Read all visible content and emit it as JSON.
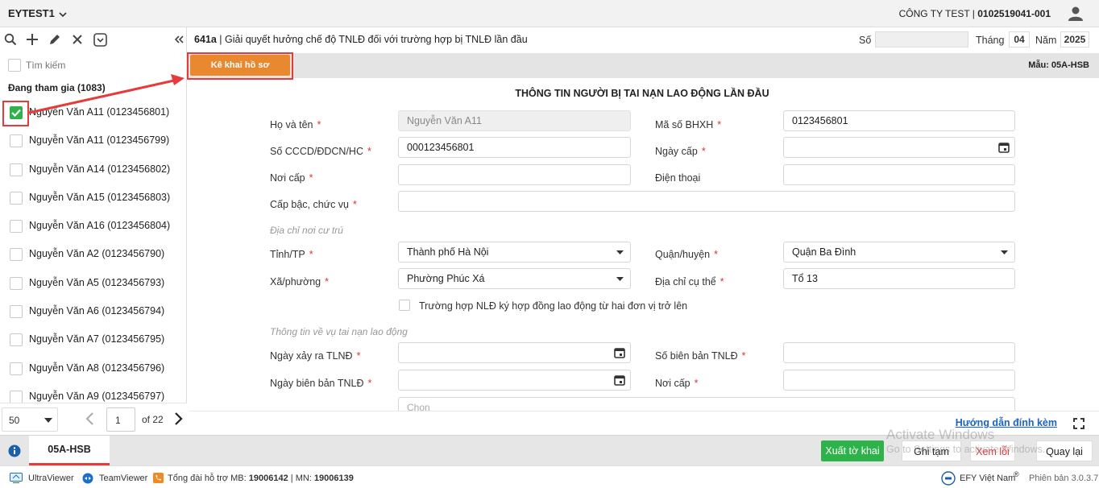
{
  "topbar": {
    "tenant": "EYTEST1",
    "company_name": "CÔNG TY TEST | ",
    "company_code": "0102519041-001"
  },
  "sidebar": {
    "search_placeholder": "Tìm kiếm",
    "group_label": "Đang tham gia (1083)",
    "items": [
      {
        "label": "Nguyễn Văn A11 (0123456801)",
        "checked": true
      },
      {
        "label": "Nguyễn Văn A11 (0123456799)",
        "checked": false
      },
      {
        "label": "Nguyễn Văn A14 (0123456802)",
        "checked": false
      },
      {
        "label": "Nguyễn Văn A15 (0123456803)",
        "checked": false
      },
      {
        "label": "Nguyễn Văn A16 (0123456804)",
        "checked": false
      },
      {
        "label": "Nguyễn Văn A2 (0123456790)",
        "checked": false
      },
      {
        "label": "Nguyễn Văn A5 (0123456793)",
        "checked": false
      },
      {
        "label": "Nguyễn Văn A6 (0123456794)",
        "checked": false
      },
      {
        "label": "Nguyễn Văn A7 (0123456795)",
        "checked": false
      },
      {
        "label": "Nguyễn Văn A8 (0123456796)",
        "checked": false
      },
      {
        "label": "Nguyễn Văn A9 (0123456797)",
        "checked": false
      }
    ],
    "pager": {
      "page_size": "50",
      "page": "1",
      "of_label": "of 22"
    }
  },
  "header": {
    "proc_code": "641a",
    "proc_title": " | Giải quyết hưởng chế độ TNLĐ đối với trường hợp bị TNLĐ lần đầu",
    "so_label": "Số",
    "so_value": "",
    "thang_label": "Tháng",
    "thang_value": "04",
    "nam_label": "Năm",
    "nam_value": "2025"
  },
  "tabbar": {
    "kekhai_label": "Kê khai hồ sơ",
    "mau_label": "Mẫu: 05A-HSB"
  },
  "form": {
    "title": "THÔNG TIN NGƯỜI BỊ TAI NẠN LAO ĐỘNG LẦN ĐẦU",
    "labels": {
      "ho_ten": "Họ và tên",
      "ma_bhxh": "Mã số BHXH",
      "cccd": "Số CCCD/ĐDCN/HC",
      "ngay_cap": "Ngày cấp",
      "noi_cap": "Nơi cấp",
      "dien_thoai": "Điện thoại",
      "cap_bac": "Cấp bậc, chức vụ",
      "tinh": "Tỉnh/TP",
      "quan": "Quận/huyện",
      "xa": "Xã/phường",
      "dia_chi": "Địa chỉ cụ thể",
      "ngay_xay_ra": "Ngày xảy ra TLNĐ",
      "so_bien_ban": "Số biên bản TNLĐ",
      "ngay_bien_ban": "Ngày biên bản TNLĐ",
      "noi_cap2": "Nơi cấp"
    },
    "values": {
      "ho_ten": "Nguyễn Văn A11",
      "ma_bhxh": "0123456801",
      "cccd": "000123456801",
      "ngay_cap": "",
      "noi_cap": "",
      "dien_thoai": "",
      "cap_bac": "",
      "tinh": "Thành phố Hà Nội",
      "quan": "Quận Ba Đình",
      "xa": "Phường Phúc Xá",
      "dia_chi": "Tổ 13",
      "ngay_xay_ra": "",
      "so_bien_ban": "",
      "ngay_bien_ban": "",
      "noi_cap2": "",
      "chon_placeholder": "Chọn"
    },
    "section_address": "Địa chỉ nơi cư trú",
    "section_accident": "Thông tin về vụ tai nạn lao động",
    "checkbox_multi": "Trường hợp NLĐ ký hợp đồng lao động từ hai đơn vị trở lên",
    "required_mark": "*"
  },
  "help_link": "Hướng dẫn đính kèm",
  "actionbar": {
    "form_tab": "05A-HSB",
    "xuat": "Xuất tờ khai",
    "ghi": "Ghi tạm",
    "xem": "Xem lỗi",
    "quay": "Quay lại"
  },
  "watermark": {
    "line1": "Activate Windows",
    "line2": "Go to Settings to activate Windows."
  },
  "footer": {
    "ultraviewer": "UltraViewer",
    "teamviewer": "TeamViewer",
    "hotline_label": "Tổng đài hỗ trợ MB: ",
    "hotline_mb": "19006142",
    "hotline_sep": " | MN: ",
    "hotline_mn": "19006139",
    "brand": "EFY Việt Nam",
    "version": "Phiên bản 3.0.3.7"
  },
  "colors": {
    "accent_orange": "#e8892f",
    "export_green": "#2eb34a",
    "annotation_red": "#e53b3b",
    "link_blue": "#1a63c6"
  }
}
